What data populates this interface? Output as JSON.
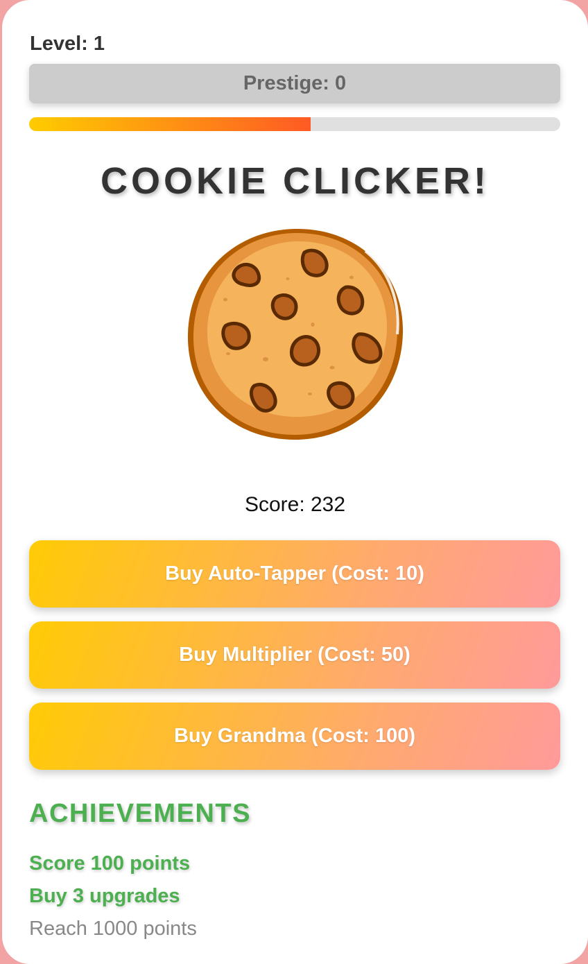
{
  "level_text": "Level: 1",
  "prestige_text": "Prestige: 0",
  "level_progress_percent": 53,
  "title": "COOKIE CLICKER!",
  "score_text": "Score: 232",
  "upgrades": [
    {
      "label": "Buy Auto-Tapper (Cost: 10)"
    },
    {
      "label": "Buy Multiplier (Cost: 50)"
    },
    {
      "label": "Buy Grandma (Cost: 100)"
    }
  ],
  "achievements": {
    "title": "ACHIEVEMENTS",
    "items": [
      {
        "label": "Score 100 points",
        "achieved": true
      },
      {
        "label": "Buy 3 upgrades",
        "achieved": true
      },
      {
        "label": "Reach 1000 points",
        "achieved": false
      }
    ]
  },
  "colors": {
    "background": "#f2a3a3",
    "achieved": "#4caf50",
    "pending": "#888888",
    "progress_start": "#ffcc00",
    "progress_end": "#ff5a24"
  }
}
